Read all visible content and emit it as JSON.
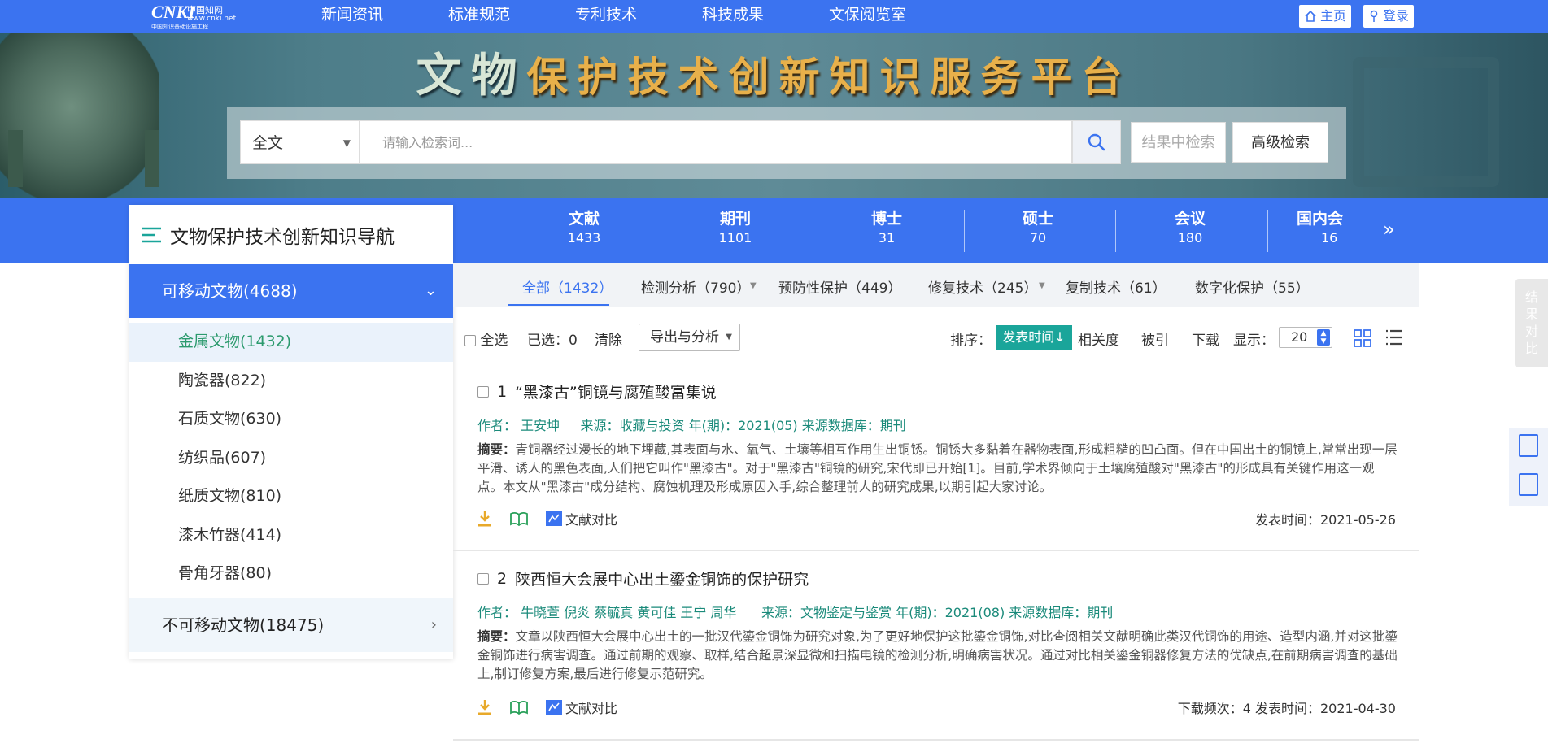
{
  "topnav": {
    "logo": {
      "brand": "CNKI",
      "cn": "中国知网",
      "url": "www.cnki.net",
      "sub": "中国知识基础设施工程"
    },
    "items": [
      "新闻资讯",
      "标准规范",
      "专利技术",
      "科技成果",
      "文保阅览室"
    ],
    "home": "主页",
    "login": "登录"
  },
  "banner": {
    "title_a": "文物",
    "title_b": "保护技术创新知识服务平台"
  },
  "search": {
    "scope": "全文",
    "placeholder": "请输入检索词...",
    "in_results": "结果中检索",
    "advanced": "高级检索"
  },
  "stats": [
    {
      "label": "文献",
      "count": "1433"
    },
    {
      "label": "期刊",
      "count": "1101"
    },
    {
      "label": "博士",
      "count": "31"
    },
    {
      "label": "硕士",
      "count": "70"
    },
    {
      "label": "会议",
      "count": "180"
    },
    {
      "label": "国内会",
      "count": "16"
    }
  ],
  "sidebar": {
    "title": "文物保护技术创新知识导航",
    "cat1": "可移动文物(4688)",
    "items": [
      "金属文物(1432)",
      "陶瓷器(822)",
      "石质文物(630)",
      "纺织品(607)",
      "纸质文物(810)",
      "漆木竹器(414)",
      "骨角牙器(80)"
    ],
    "cat2": "不可移动文物(18475)"
  },
  "tabs": [
    "全部（1432）",
    "检测分析（790）",
    "预防性保护（449）",
    "修复技术（245）",
    "复制技术（61）",
    "数字化保护（55）"
  ],
  "toolbar": {
    "select_all": "全选",
    "selected": "已选：0",
    "clear": "清除",
    "export": "导出与分析",
    "sort_label": "排序：",
    "sort_active": "发表时间↓",
    "relevance": "相关度",
    "cited": "被引",
    "downloads": "下载",
    "display": "显示：",
    "page_size": "20"
  },
  "results": [
    {
      "num": "1",
      "title": "“黑漆古”铜镜与腐殖酸富集说",
      "authors": "作者： 王安坤",
      "source": "来源：收藏与投资 年(期)：2021(05) 来源数据库：期刊",
      "abstract_label": "摘要：",
      "abstract": "青铜器经过漫长的地下埋藏,其表面与水、氧气、土壤等相互作用生出铜锈。铜锈大多黏着在器物表面,形成粗糙的凹凸面。但在中国出土的铜镜上,常常出现一层平滑、诱人的黑色表面,人们把它叫作\"黑漆古\"。对于\"黑漆古\"铜镜的研究,宋代即已开始[1]。目前,学术界倾向于土壤腐殖酸对\"黑漆古\"的形成具有关键作用这一观点。本文从\"黑漆古\"成分结构、腐蚀机理及形成原因入手,综合整理前人的研究成果,以期引起大家讨论。",
      "compare": "文献对比",
      "date": "发表时间：2021-05-26"
    },
    {
      "num": "2",
      "title": "陕西恒大会展中心出土鎏金铜饰的保护研究",
      "authors": "作者： 牛晓萱  倪炎  蔡毓真  黄可佳  王宁  周华",
      "source": "来源：文物鉴定与鉴赏 年(期)：2021(08) 来源数据库：期刊",
      "abstract_label": "摘要：",
      "abstract": "文章以陕西恒大会展中心出土的一批汉代鎏金铜饰为研究对象,为了更好地保护这批鎏金铜饰,对比查阅相关文献明确此类汉代铜饰的用途、造型内涵,并对这批鎏金铜饰进行病害调查。通过前期的观察、取样,结合超景深显微和扫描电镜的检测分析,明确病害状况。通过对比相关鎏金铜器修复方法的优缺点,在前期病害调查的基础上,制订修复方案,最后进行修复示范研究。",
      "compare": "文献对比",
      "date": "下载频次：4 发表时间：2021-04-30"
    }
  ],
  "float": {
    "compare": "结果对比"
  },
  "colors": {
    "primary": "#3b73f0",
    "teal": "#1aa59a",
    "meta": "#1a8a7a",
    "gold": "#e8b04a"
  }
}
